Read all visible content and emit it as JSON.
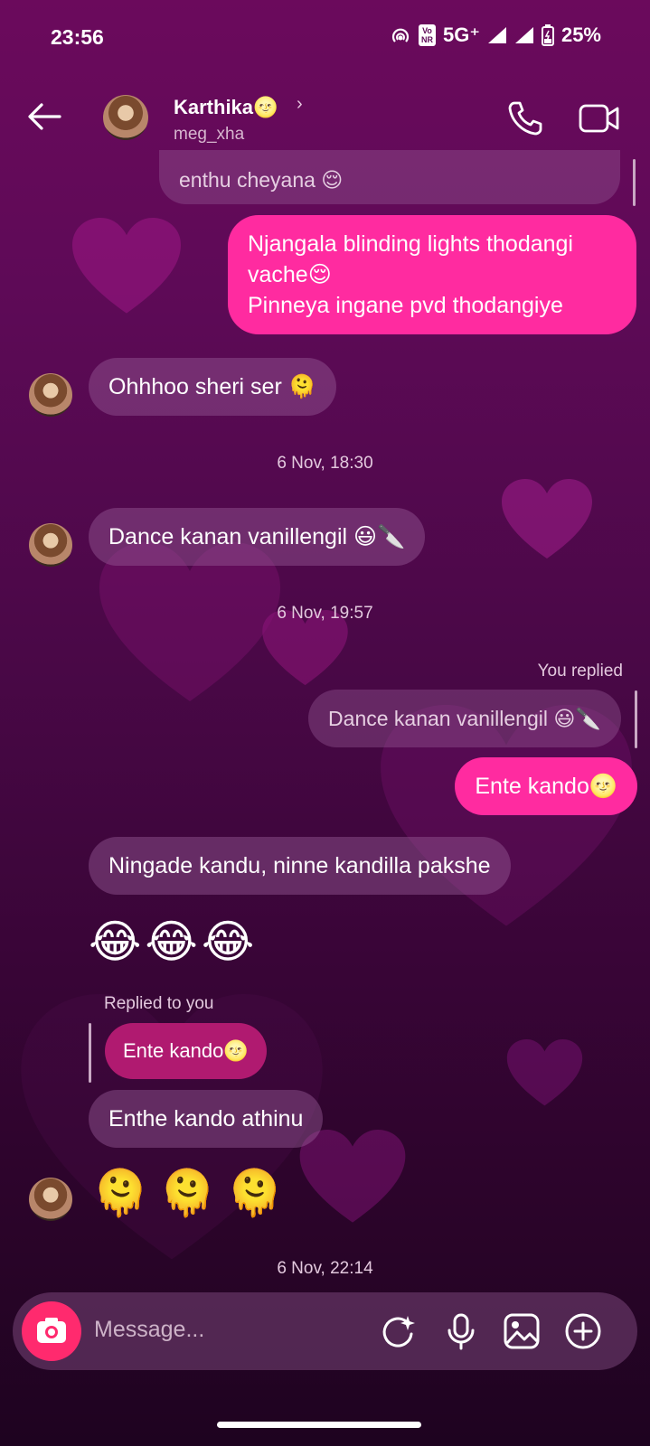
{
  "status_bar": {
    "time": "23:56",
    "network": "5G⁺",
    "volte": "Vo\nNR",
    "battery": "25%"
  },
  "header": {
    "name": "Karthika🌝",
    "username": "meg_xha",
    "chevron": "›"
  },
  "messages": {
    "m1_quoted": "enthu cheyana 😌",
    "m2_out": "Njangala blinding lights thodangi vache😌\nPinneya ingane pvd thodangiye",
    "m3_in": "Ohhhoo sheri ser 🫠",
    "ts1": "6 Nov, 18:30",
    "m4_in": "Dance kanan vanillengil 😃🔪",
    "ts2": "6 Nov, 19:57",
    "you_replied": "You replied",
    "m5_quoted": "Dance kanan vanillengil 😃🔪",
    "m5_out": "Ente kando🌝",
    "m6_in": "Ningade kandu, ninne kandilla pakshe",
    "m7_emoji": "😂😂😂",
    "replied_to_you": "Replied to you",
    "m8_quoted": "Ente kando🌝",
    "m8_in": "Enthe kando athinu",
    "m9_emoji": "🫠🫠🫠",
    "ts3": "6 Nov, 22:14"
  },
  "composer": {
    "placeholder": "Message..."
  },
  "colors": {
    "outgoing_bubble": "#ff2ba0",
    "camera_button": "#ff2a6e",
    "background_top": "#6b0a5c",
    "background_bottom": "#1e0320"
  },
  "icons": [
    "back-arrow-icon",
    "phone-icon",
    "video-camera-icon",
    "camera-icon",
    "sticker-icon",
    "microphone-icon",
    "gallery-icon",
    "plus-icon"
  ]
}
